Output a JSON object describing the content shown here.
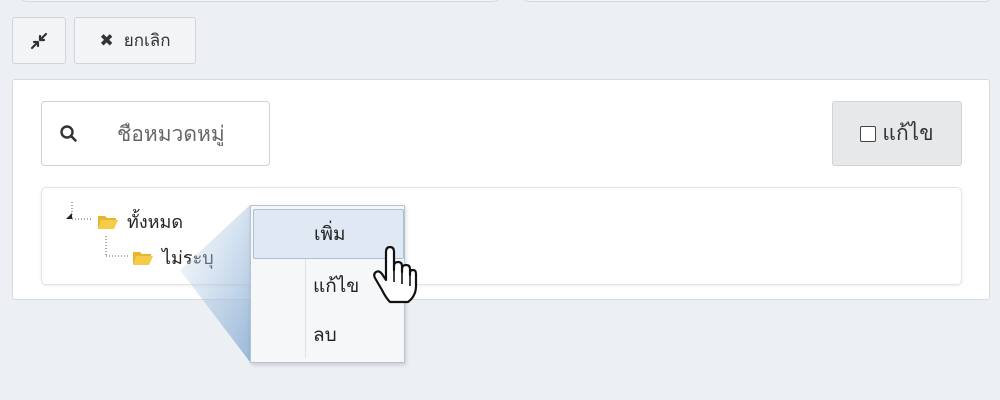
{
  "toolbar": {
    "collapse_icon": "compress-arrows-icon",
    "cancel_icon": "times-icon",
    "cancel_label": "ยกเลิก"
  },
  "search": {
    "icon": "search-icon",
    "placeholder": "ชื่อหมวดหมู่",
    "value": ""
  },
  "edit_toggle": {
    "checked": false,
    "label": "แก้ไข"
  },
  "tree": {
    "root": {
      "label": "ทั้งหมด",
      "icon": "folder-open-icon",
      "expanded": true
    },
    "children": [
      {
        "label": "ไม่ระบุ",
        "icon": "folder-open-icon"
      }
    ]
  },
  "context_menu": {
    "items": [
      {
        "label": "เพิ่ม",
        "active": true
      },
      {
        "label": "แก้ไข",
        "active": false
      },
      {
        "label": "ลบ",
        "active": false
      }
    ]
  },
  "colors": {
    "background": "#eceff3",
    "folder": "#f2c744",
    "menu_active": "#dfe8f3",
    "callout": "#a9c4e0"
  }
}
